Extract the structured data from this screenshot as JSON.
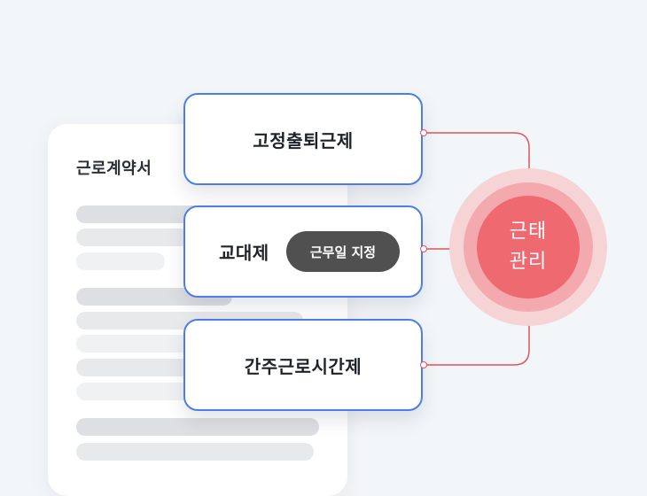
{
  "document": {
    "title": "근로계약서"
  },
  "work_types": [
    {
      "label": "고정출퇴근제"
    },
    {
      "label": "교대제",
      "badge": "근무일 지정"
    },
    {
      "label": "간주근로시간제"
    }
  ],
  "hub": {
    "line1": "근태",
    "line2": "관리"
  },
  "colors": {
    "card_border": "#4b7fe3",
    "hub_core": "#ef6a70",
    "connector": "#e2545c",
    "badge_bg": "#505050"
  }
}
